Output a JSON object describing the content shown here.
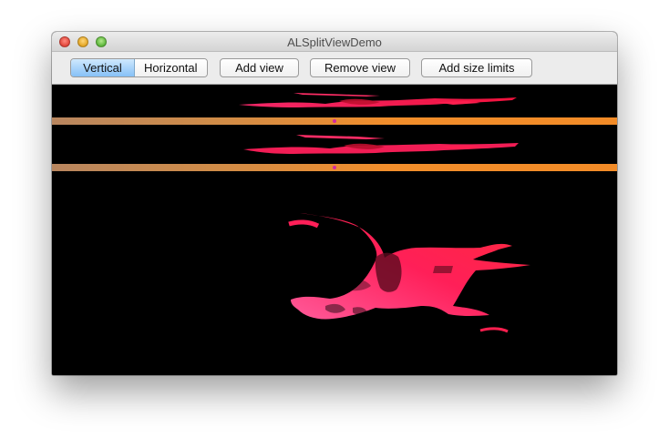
{
  "window": {
    "title": "ALSplitViewDemo"
  },
  "toolbar": {
    "orientation": {
      "options": [
        "Vertical",
        "Horizontal"
      ],
      "selected": "Vertical"
    },
    "add_view_label": "Add view",
    "remove_view_label": "Remove view",
    "add_size_limits_label": "Add size limits"
  },
  "split_view": {
    "orientation": "Vertical",
    "pane_count": 3,
    "divider_color": "#F28E2B",
    "handle_color": "#D22AA2",
    "content_background": "#000000",
    "artwork_color": "#FF1E56"
  }
}
